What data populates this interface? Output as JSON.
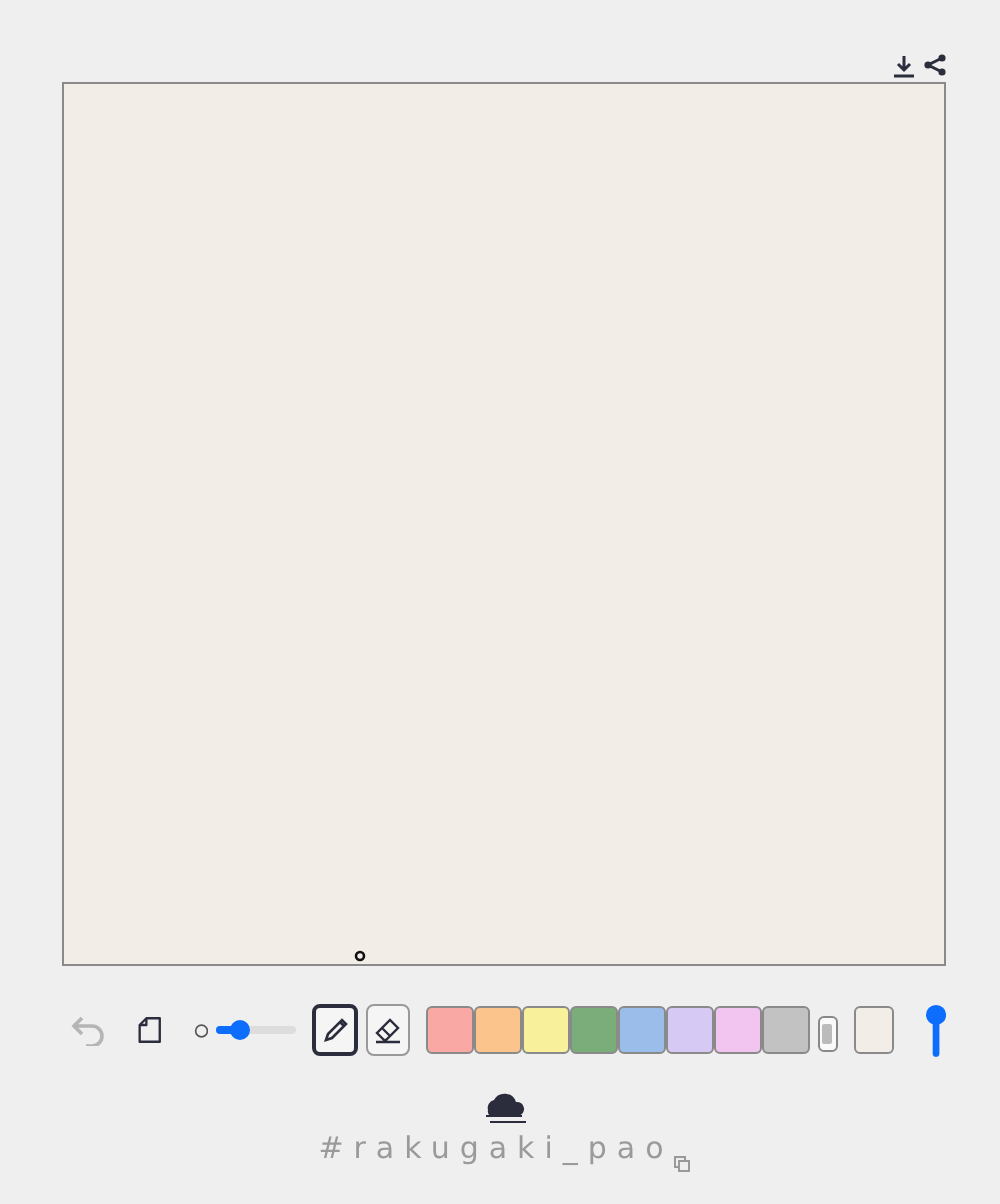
{
  "canvas": {
    "color": "#f2eee7"
  },
  "toolbar": {
    "undo": {
      "disabled": true
    },
    "brush_size": {
      "level": 0.3
    },
    "tools": [
      {
        "kind": "pencil",
        "selected": true
      },
      {
        "kind": "eraser",
        "selected": false
      }
    ],
    "palette": [
      {
        "color": "#f9a8a4",
        "selected": false
      },
      {
        "color": "#fac48c",
        "selected": false
      },
      {
        "color": "#f8f09a",
        "selected": false
      },
      {
        "color": "#7aad7a",
        "selected": false
      },
      {
        "color": "#9bbde9",
        "selected": false
      },
      {
        "color": "#d6c9f3",
        "selected": false
      },
      {
        "color": "#f1c5ef",
        "selected": false
      },
      {
        "color": "#c2c2c2",
        "selected": false
      }
    ],
    "background_swatch": {
      "color": "#f2eee7"
    }
  },
  "footer": {
    "hashtag": "#rakugaki_pao"
  }
}
